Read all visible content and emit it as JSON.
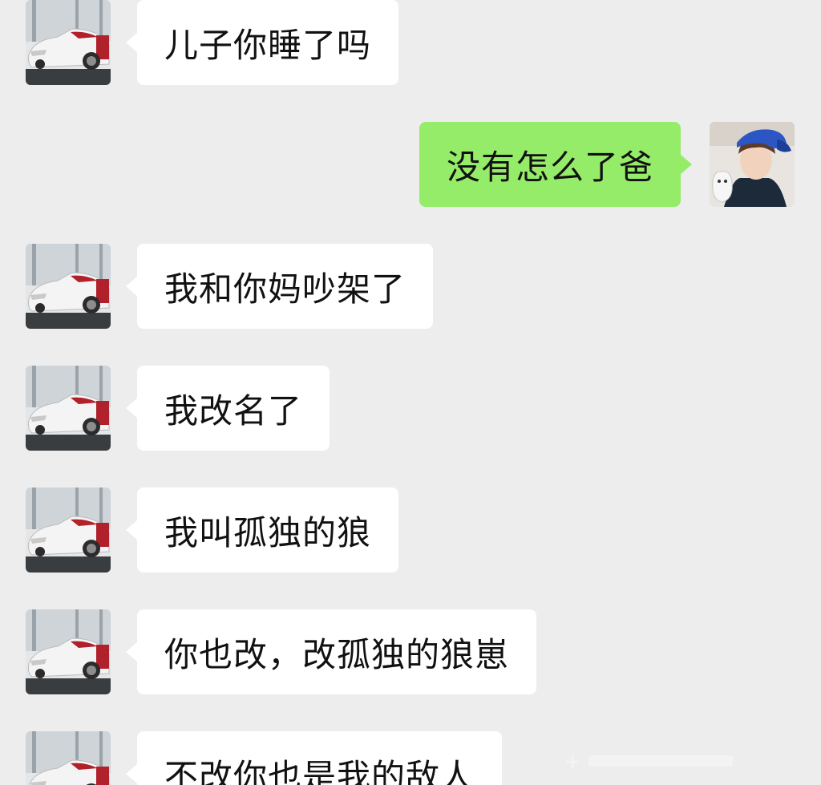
{
  "colors": {
    "background": "#ededed",
    "incoming_bubble": "#ffffff",
    "outgoing_bubble": "#95ec69",
    "text": "#111111"
  },
  "avatars": {
    "dad": "car-avatar-icon",
    "son": "boy-with-cap-avatar-icon"
  },
  "messages": [
    {
      "sender": "dad",
      "text": "儿子你睡了吗"
    },
    {
      "sender": "son",
      "text": "没有怎么了爸"
    },
    {
      "sender": "dad",
      "text": "我和你妈吵架了"
    },
    {
      "sender": "dad",
      "text": "我改名了"
    },
    {
      "sender": "dad",
      "text": "我叫孤独的狼"
    },
    {
      "sender": "dad",
      "text": "你也改，改孤独的狼崽"
    },
    {
      "sender": "dad",
      "text": "不改你也是我的敌人"
    }
  ]
}
